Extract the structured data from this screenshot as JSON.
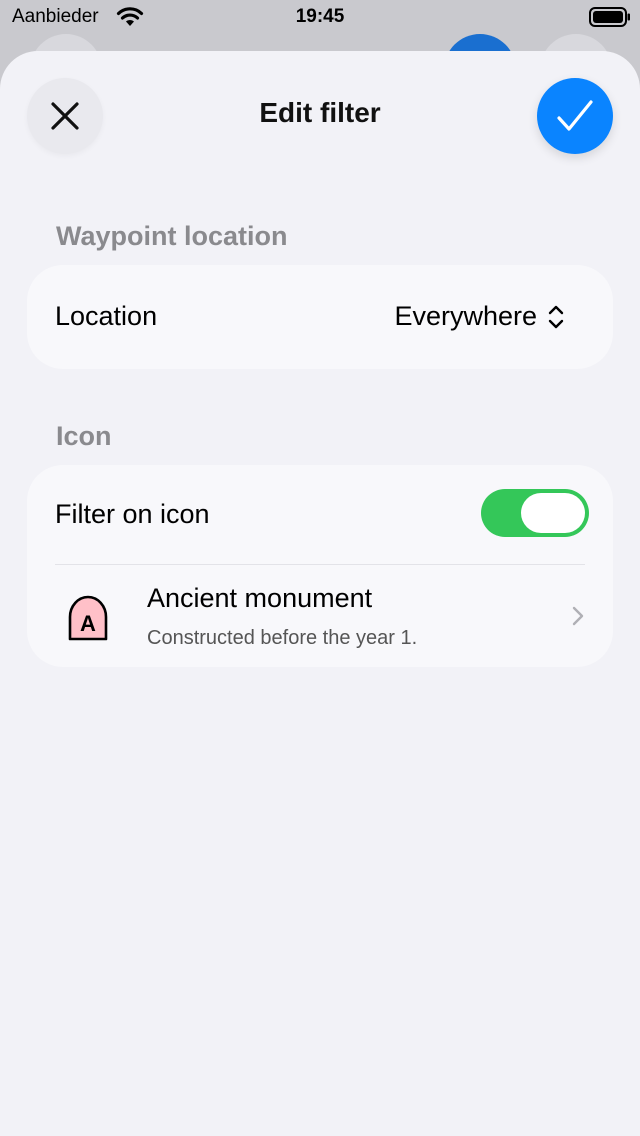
{
  "status_bar": {
    "carrier": "Aanbieder",
    "time": "19:45"
  },
  "sheet": {
    "title": "Edit filter"
  },
  "waypoint_section": {
    "header": "Waypoint location",
    "location_label": "Location",
    "location_value": "Everywhere"
  },
  "icon_section": {
    "header": "Icon",
    "filter_label": "Filter on icon",
    "filter_enabled": true,
    "item": {
      "title": "Ancient monument",
      "subtitle": "Constructed before the year 1.",
      "icon_letter": "A"
    }
  },
  "colors": {
    "accent": "#0a84ff",
    "toggle_on": "#34c759",
    "sheet_bg": "#f2f2f7",
    "card_bg": "#f8f8fb",
    "section_header": "#8a8a8e",
    "monument_fill": "#ffc0c8"
  }
}
